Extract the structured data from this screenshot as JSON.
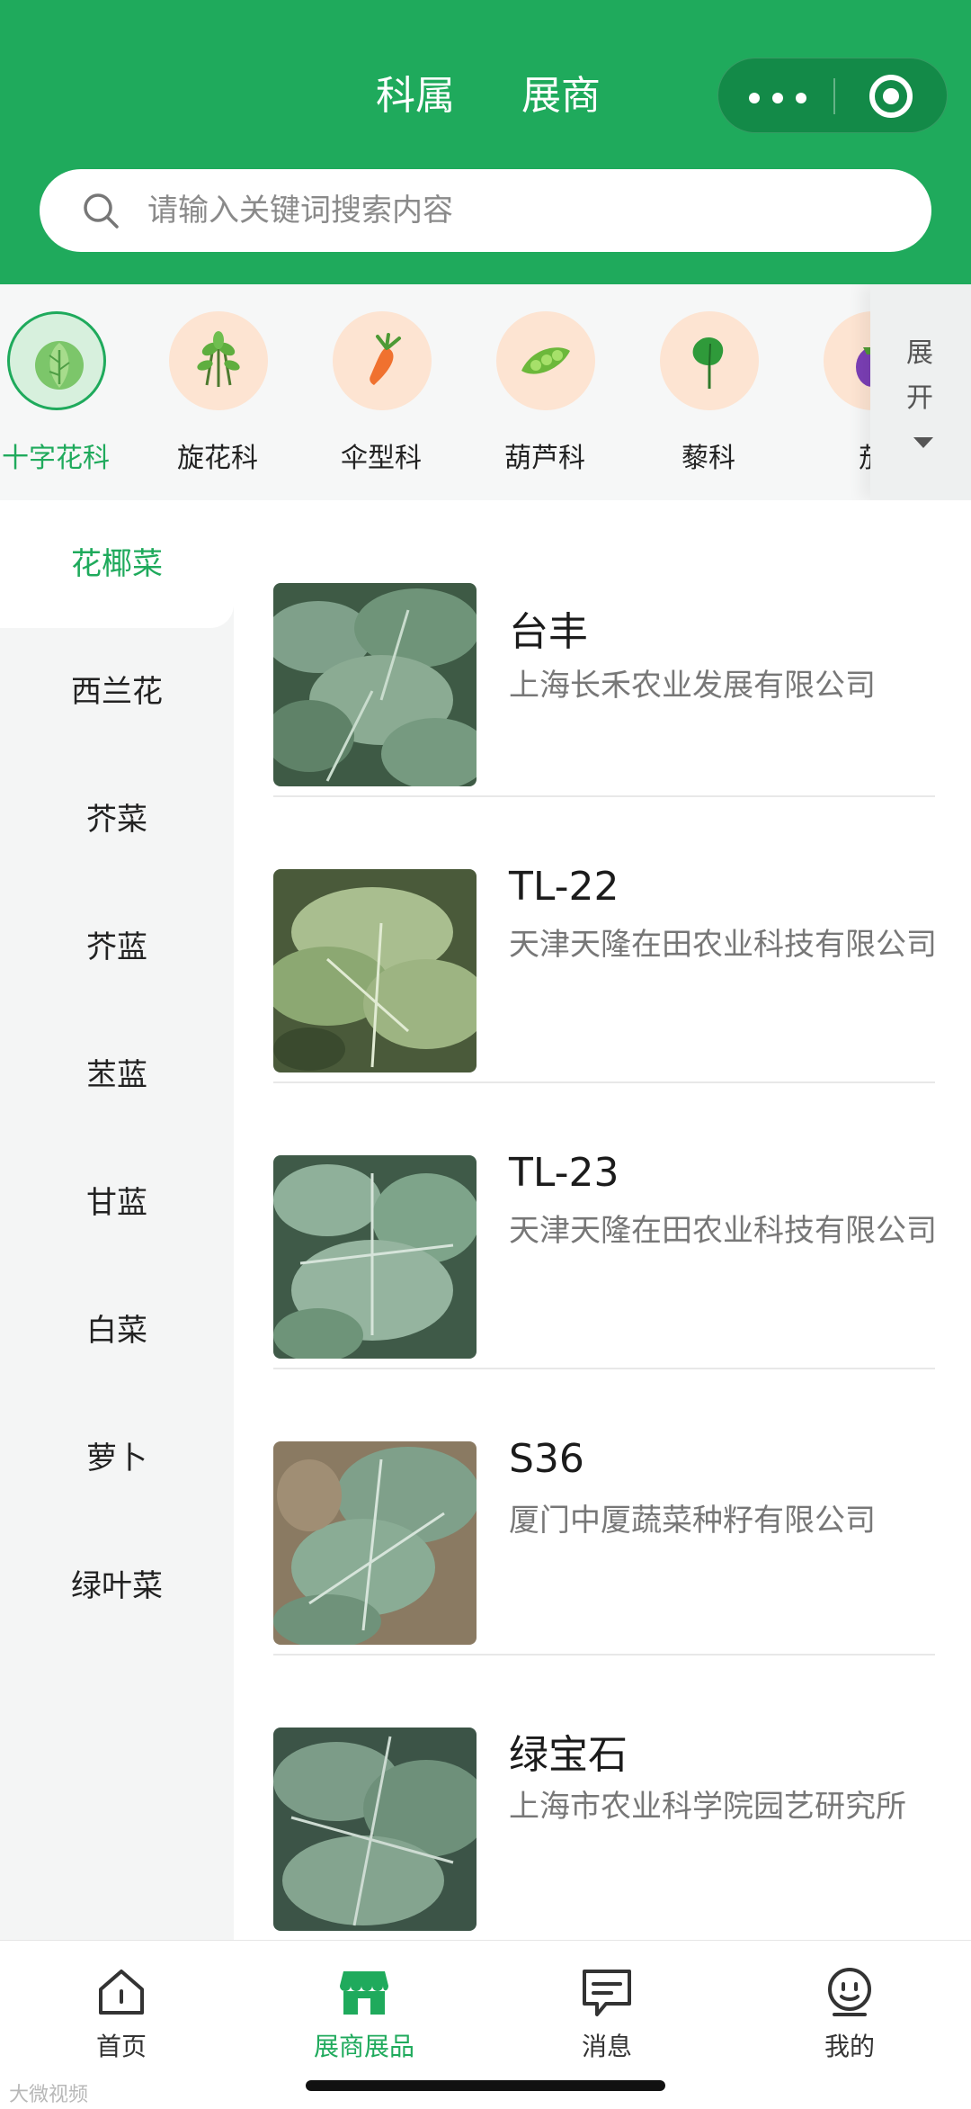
{
  "header": {
    "tabs": [
      "科属",
      "展商"
    ],
    "search_placeholder": "请输入关键词搜索内容"
  },
  "categories": {
    "items": [
      {
        "label": "十字花科",
        "icon": "cabbage-icon",
        "active": true
      },
      {
        "label": "旋花科",
        "icon": "sprout-icon",
        "active": false
      },
      {
        "label": "伞型科",
        "icon": "carrot-icon",
        "active": false
      },
      {
        "label": "葫芦科",
        "icon": "pea-pod-icon",
        "active": false
      },
      {
        "label": "藜科",
        "icon": "spinach-icon",
        "active": false
      },
      {
        "label": "茄",
        "icon": "eggplant-icon",
        "active": false
      }
    ],
    "expand_label": "展开"
  },
  "sidebar": {
    "items": [
      "花椰菜",
      "西兰花",
      "芥菜",
      "芥蓝",
      "苤蓝",
      "甘蓝",
      "白菜",
      "萝卜",
      "绿叶菜"
    ],
    "active_index": 0
  },
  "list": {
    "items": [
      {
        "name": "台丰",
        "company": "上海长禾农业发展有限公司"
      },
      {
        "name": "TL-22",
        "company": "天津天隆在田农业科技有限公司"
      },
      {
        "name": "TL-23",
        "company": "天津天隆在田农业科技有限公司"
      },
      {
        "name": "S36",
        "company": "厦门中厦蔬菜种籽有限公司"
      },
      {
        "name": "绿宝石",
        "company": "上海市农业科学院园艺研究所"
      }
    ]
  },
  "bottom_nav": {
    "items": [
      {
        "label": "首页",
        "icon": "home-icon",
        "active": false
      },
      {
        "label": "展商展品",
        "icon": "store-icon",
        "active": true
      },
      {
        "label": "消息",
        "icon": "message-icon",
        "active": false
      },
      {
        "label": "我的",
        "icon": "profile-icon",
        "active": false
      }
    ]
  },
  "watermark": "大微视频",
  "colors": {
    "accent": "#1faa5c",
    "header_bg": "#1faa5c",
    "capsule_bg": "#138a48"
  }
}
